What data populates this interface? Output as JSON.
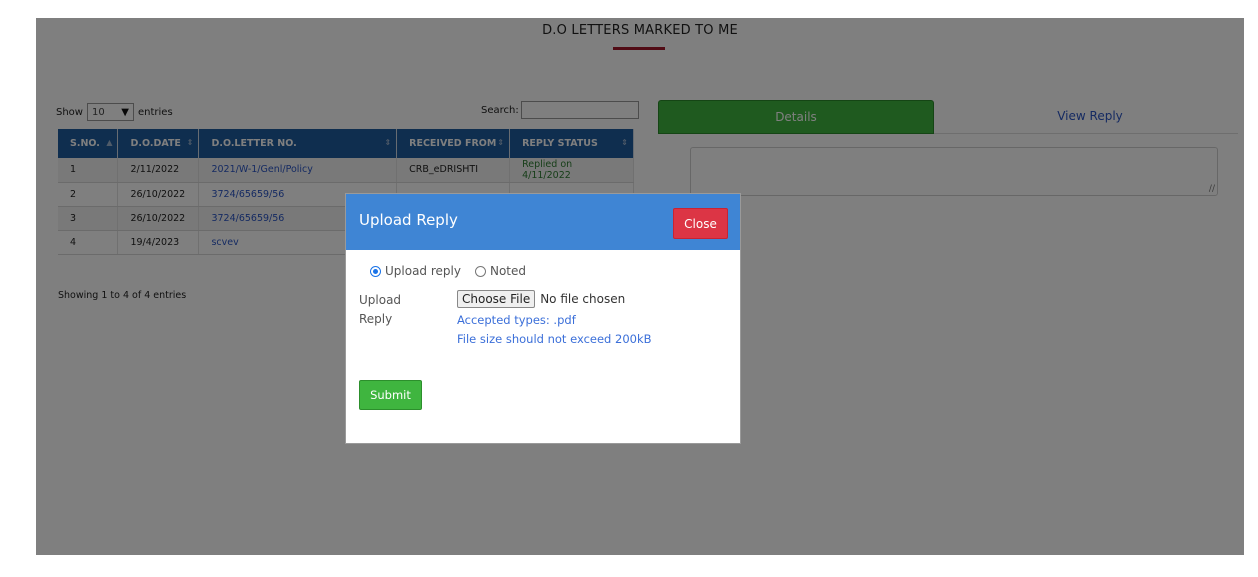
{
  "page": {
    "title": "D.O LETTERS MARKED TO ME"
  },
  "table_controls": {
    "show_label": "Show",
    "length_value": "10",
    "entries_label": "entries",
    "search_label": "Search:",
    "info": "Showing 1 to 4 of 4 entries"
  },
  "table": {
    "columns": [
      "S.NO.",
      "D.O.DATE",
      "D.O.LETTER NO.",
      "RECEIVED FROM",
      "REPLY STATUS"
    ],
    "rows": [
      {
        "sno": "1",
        "date": "2/11/2022",
        "letter_no": "2021/W-1/Genl/Policy",
        "received_from": "CRB_eDRISHTI",
        "status": "Replied on 4/11/2022"
      },
      {
        "sno": "2",
        "date": "26/10/2022",
        "letter_no": "3724/65659/56",
        "received_from": "",
        "status": ""
      },
      {
        "sno": "3",
        "date": "26/10/2022",
        "letter_no": "3724/65659/56",
        "received_from": "",
        "status": ""
      },
      {
        "sno": "4",
        "date": "19/4/2023",
        "letter_no": "scvev",
        "received_from": "",
        "status": ""
      }
    ]
  },
  "tabs": {
    "details": "Details",
    "view_reply": "View Reply"
  },
  "modal": {
    "title": "Upload Reply",
    "close_label": "Close",
    "radio_upload": "Upload reply",
    "radio_noted": "Noted",
    "selected": "Upload reply",
    "upload_label": "Upload Reply",
    "choose_file": "Choose File",
    "no_file": "No file chosen",
    "accepted_types": "Accepted types: .pdf",
    "size_hint": "File size should not exceed 200kB",
    "submit_label": "Submit"
  },
  "colors": {
    "header_blue": "#1f5c9e",
    "modal_header": "#3f85d4",
    "close_red": "#dc3545",
    "success_green": "#3fb53f",
    "title_underline": "#a3182a",
    "link_blue": "#2a55c4"
  }
}
